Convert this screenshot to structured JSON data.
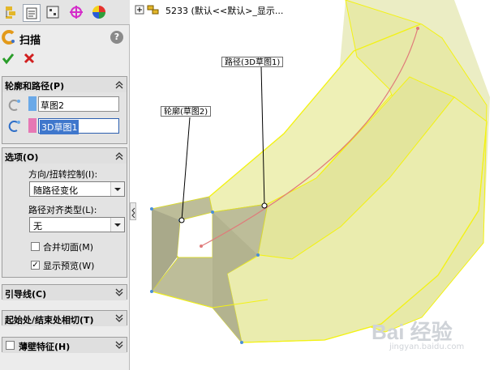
{
  "feature": {
    "title": "扫描",
    "help": "?"
  },
  "profile_path": {
    "header": "轮廓和路径(P)",
    "profile_value": "草图2",
    "path_value": "3D草图1",
    "profile_color": "#6aa9e8",
    "path_color": "#e678b4"
  },
  "options": {
    "header": "选项(O)",
    "orient_label": "方向/扭转控制(I):",
    "orient_value": "随路径变化",
    "align_label": "路径对齐类型(L):",
    "align_value": "无",
    "merge_label": "合并切面(M)",
    "merge_checked": false,
    "preview_label": "显示预览(W)",
    "preview_checked": true,
    "preview_check_glyph": "✓"
  },
  "guides": {
    "header": "引导线(C)"
  },
  "start_end": {
    "header": "起始处/结束处相切(T)"
  },
  "thin": {
    "header": "薄壁特征(H)",
    "checked": false
  },
  "tree": {
    "label": "5233  (默认<<默认>_显示..."
  },
  "callouts": {
    "profile": "轮廓(草图2)",
    "path": "路径(3D草图1)"
  },
  "watermark": {
    "logo": "Bai 经验",
    "url": "jingyan.baidu.com"
  },
  "colors": {
    "accent_green": "#2a9d2a",
    "cancel_red": "#d11f1f",
    "sweep_fill": "#e9ecaa",
    "sweep_edge": "#f3f214",
    "path_line": "#e07a7a"
  }
}
